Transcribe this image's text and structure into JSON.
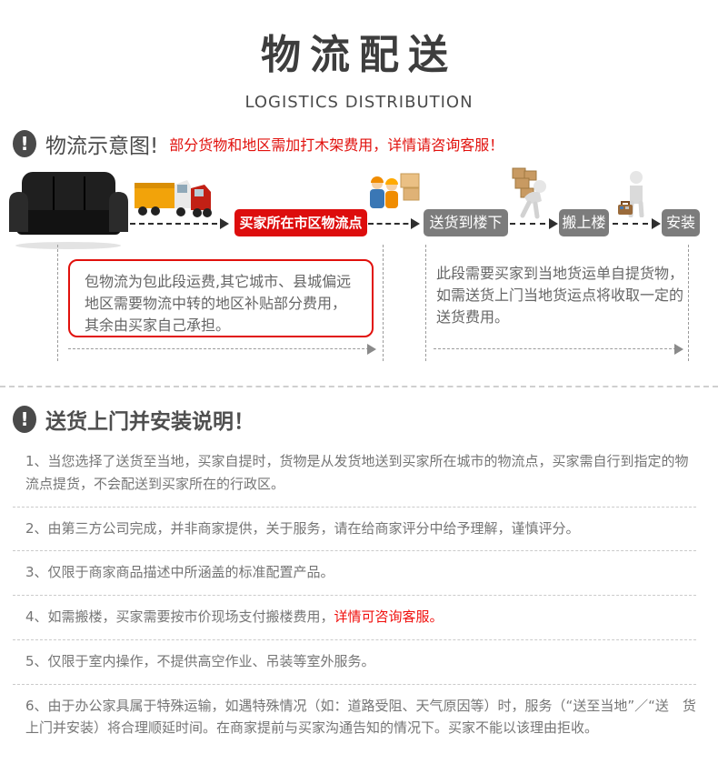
{
  "header": {
    "title": "物流配送",
    "subtitle": "LOGISTICS DISTRIBUTION"
  },
  "diagram": {
    "heading": "物流示意图!",
    "note": "部分货物和地区需加打木架费用，详情请咨询客服！",
    "flow": {
      "start_image": "sofa",
      "steps": [
        {
          "label": "买家所在市区物流点",
          "style": "red",
          "image_before": "trucks-icon"
        },
        {
          "label": "送货到楼下",
          "style": "gray",
          "image_before": "delivery-workers-icon"
        },
        {
          "label": "搬上楼",
          "style": "gray",
          "image_before": "porter-carrying-boxes-icon"
        },
        {
          "label": "安装",
          "style": "gray",
          "image_before": "installer-with-toolbox-icon"
        }
      ]
    },
    "left_note": "包物流为包此段运费,其它城市、县城偏远地区需要物流中转的地区补贴部分费用，其余由买家自己承担。",
    "right_note": "此段需要买家到当地货运单自提货物，如需送货上门当地货运点将收取一定的送货费用。"
  },
  "instructions": {
    "heading": "送货上门并安装说明！",
    "items": [
      {
        "text": "1、当您选择了送货至当地，买家自提时，货物是从发货地送到买家所在城市的物流点，买家需自行到指定的物流点提货，不会配送到买家所在的行政区。",
        "red_text": ""
      },
      {
        "text": "2、由第三方公司完成，并非商家提供，关于服务，请在给商家评分中给予理解，谨慎评分。",
        "red_text": ""
      },
      {
        "text": "3、仅限于商家商品描述中所涵盖的标准配置产品。",
        "red_text": ""
      },
      {
        "text": "4、如需搬楼，买家需要按市价现场支付搬楼费用，",
        "red_text": "详情可咨询客服。"
      },
      {
        "text": "5、仅限于室内操作，不提供高空作业、吊装等室外服务。",
        "red_text": ""
      },
      {
        "text": "6、由于办公家具属于特殊运输，如遇特殊情况（如：道路受阻、天气原因等）时，服务（“送至当地”／“送　货上门并安装）将合理顺延时间。在商家提前与买家沟通告知的情况下。买家不能以该理由拒收。",
        "red_text": ""
      }
    ]
  },
  "colors": {
    "accent_red": "#dd0d0d",
    "note_red": "#e1100c",
    "button_gray": "#7c7c7c",
    "heading_gray": "#4a4a4a",
    "body_text": "#757575"
  }
}
